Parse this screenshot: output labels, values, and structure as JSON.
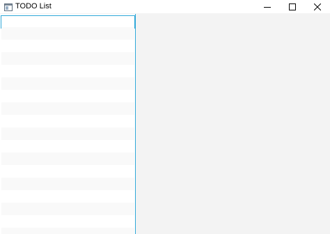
{
  "window": {
    "title": "TODO List",
    "icons": {
      "app": "app-window-icon",
      "minimize": "minimize-icon",
      "maximize": "maximize-icon",
      "close": "close-icon"
    }
  },
  "todo_list": {
    "items": [
      "",
      "",
      "",
      "",
      "",
      "",
      "",
      "",
      "",
      "",
      "",
      "",
      "",
      "",
      "",
      "",
      "",
      ""
    ],
    "selected_index": 0
  },
  "colors": {
    "selection_border": "#2ea7d8",
    "row_alt": "#f9f9f9",
    "detail_background": "#f3f3f3"
  }
}
